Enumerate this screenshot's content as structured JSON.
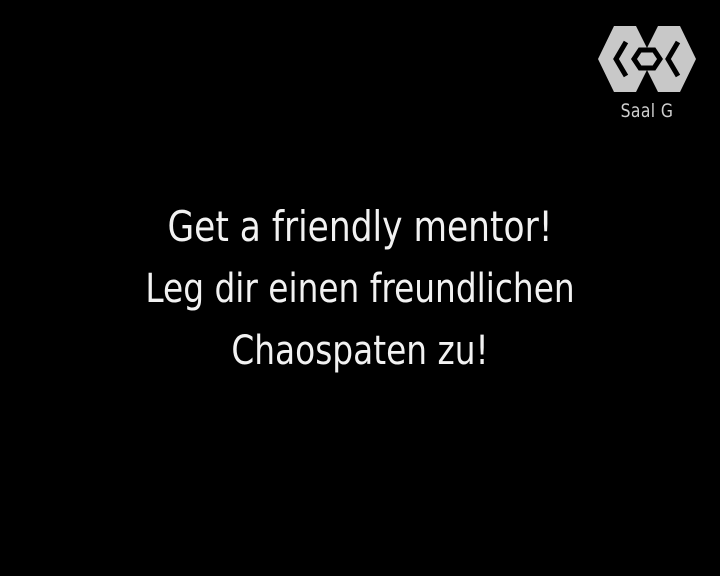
{
  "logo": {
    "icon": "conference-logo-icon",
    "fill": "#c8c8c8",
    "cutout": "#000000"
  },
  "room": {
    "label": "Saal G"
  },
  "message": {
    "line1": "Get a friendly mentor!",
    "line2": "Leg dir einen freundlichen",
    "line3": "Chaospaten zu!"
  }
}
